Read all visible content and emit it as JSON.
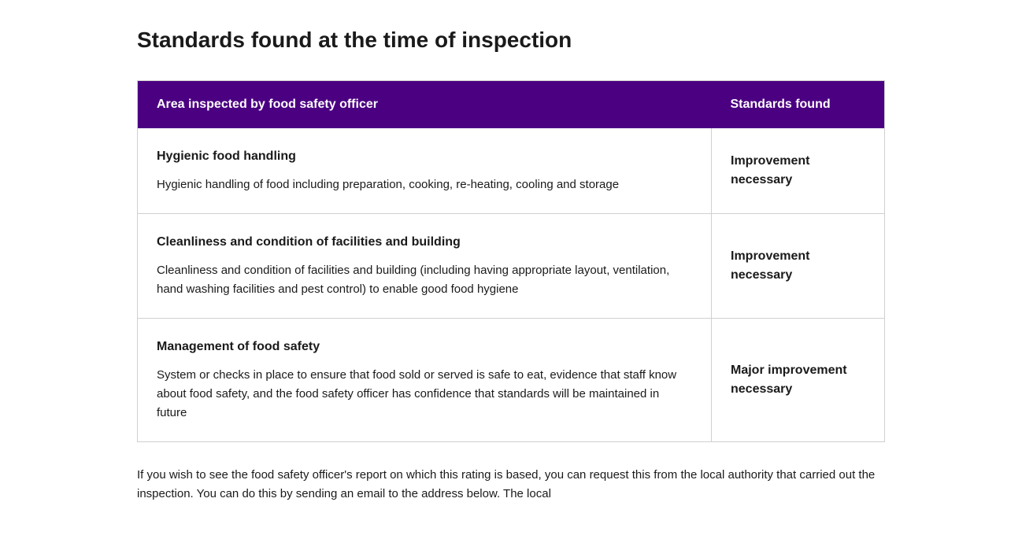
{
  "page": {
    "title": "Standards found at the time of inspection"
  },
  "table": {
    "header": {
      "area_col": "Area inspected by food safety officer",
      "standards_col": "Standards found"
    },
    "rows": [
      {
        "id": "row-1",
        "area_title": "Hygienic food handling",
        "area_description": "Hygienic handling of food including preparation, cooking, re-heating, cooling and storage",
        "standards": "Improvement necessary"
      },
      {
        "id": "row-2",
        "area_title": "Cleanliness and condition of facilities and building",
        "area_description": "Cleanliness and condition of facilities and building (including having appropriate layout, ventilation, hand washing facilities and pest control) to enable good food hygiene",
        "standards": "Improvement necessary"
      },
      {
        "id": "row-3",
        "area_title": "Management of food safety",
        "area_description": "System or checks in place to ensure that food sold or served is safe to eat, evidence that staff know about food safety, and the food safety officer has confidence that standards will be maintained in future",
        "standards": "Major improvement necessary"
      }
    ]
  },
  "footer": {
    "text": "If you wish to see the food safety officer's report on which this rating is based, you can request this from the local authority that carried out the inspection. You can do this by sending an email to the address below. The local"
  },
  "colors": {
    "header_bg": "#4b0082",
    "header_text": "#ffffff",
    "body_text": "#1a1a1a",
    "border": "#d0d0d0"
  }
}
